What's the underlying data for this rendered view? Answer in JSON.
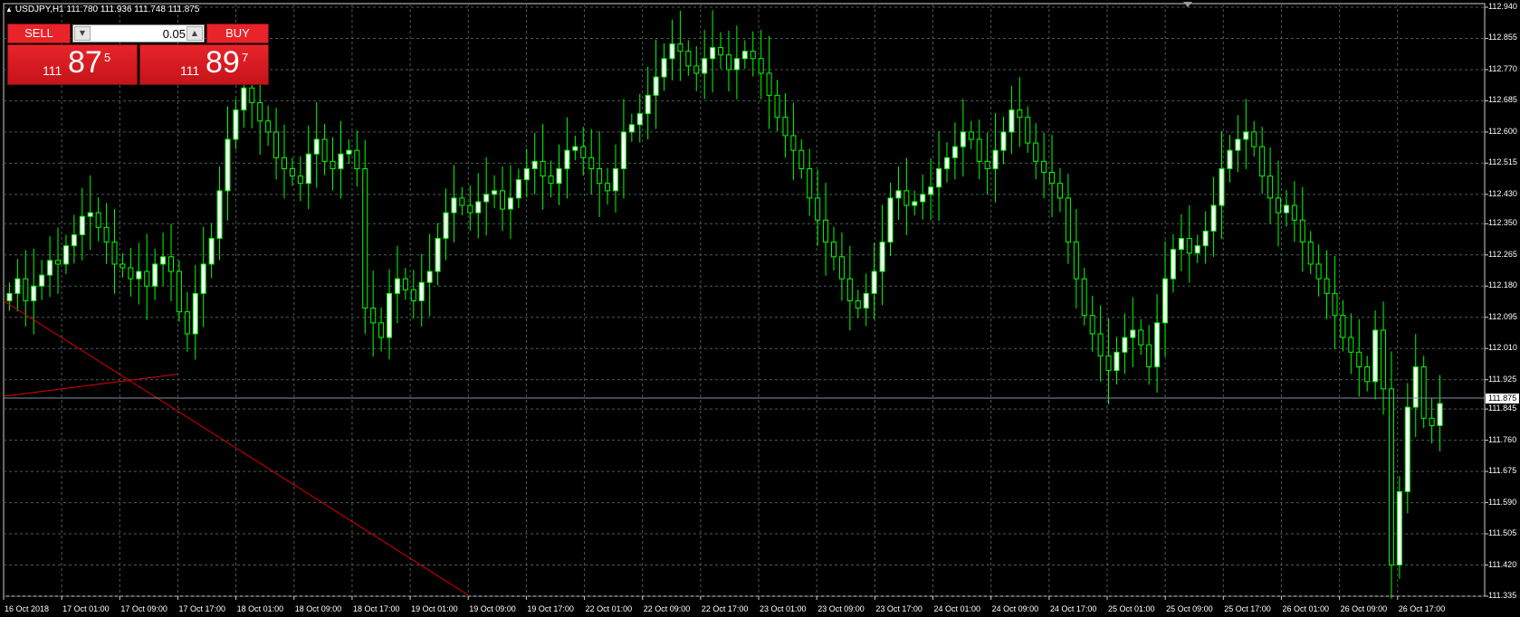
{
  "header": {
    "symbol_line": "USDJPY,H1  111.780 111.936 111.748 111.875"
  },
  "trade_panel": {
    "sell_label": "SELL",
    "buy_label": "BUY",
    "lot": "0.05",
    "sell_price": {
      "prefix": "111",
      "big": "87",
      "sup": "5"
    },
    "buy_price": {
      "prefix": "111",
      "big": "89",
      "sup": "7"
    }
  },
  "current_price_label": "111.875",
  "colors": {
    "background": "#000000",
    "grid": "#4a5a5a",
    "candle_bull": "#ffffff",
    "candle_bear": "#000000",
    "candle_outline": "#00ff00",
    "trendline": "#e00000",
    "bid_line": "#7f8fa6",
    "button": "#e8232a"
  },
  "chart_data": {
    "type": "candlestick",
    "symbol": "USDJPY",
    "timeframe": "H1",
    "ylim": [
      111.335,
      112.94
    ],
    "y_ticks": [
      "112.940",
      "112.855",
      "112.770",
      "112.685",
      "112.600",
      "112.515",
      "112.430",
      "112.350",
      "112.265",
      "112.180",
      "112.095",
      "112.010",
      "111.925",
      "111.845",
      "111.760",
      "111.675",
      "111.590",
      "111.505",
      "111.420",
      "111.335"
    ],
    "x_ticks": [
      "16 Oct 2018",
      "17 Oct 01:00",
      "17 Oct 09:00",
      "17 Oct 17:00",
      "18 Oct 01:00",
      "18 Oct 09:00",
      "18 Oct 17:00",
      "19 Oct 01:00",
      "19 Oct 09:00",
      "19 Oct 17:00",
      "22 Oct 01:00",
      "22 Oct 09:00",
      "22 Oct 17:00",
      "23 Oct 01:00",
      "23 Oct 09:00",
      "23 Oct 17:00",
      "24 Oct 01:00",
      "24 Oct 09:00",
      "24 Oct 17:00",
      "25 Oct 01:00",
      "25 Oct 09:00",
      "25 Oct 17:00",
      "26 Oct 01:00",
      "26 Oct 09:00",
      "26 Oct 17:00"
    ],
    "grid": true,
    "current_price": 111.875,
    "candles_close": [
      112.16,
      112.2,
      112.14,
      112.18,
      112.21,
      112.25,
      112.24,
      112.29,
      112.32,
      112.37,
      112.38,
      112.34,
      112.3,
      112.24,
      112.23,
      112.2,
      112.22,
      112.18,
      112.24,
      112.26,
      112.22,
      112.11,
      112.05,
      112.16,
      112.24,
      112.31,
      112.44,
      112.58,
      112.66,
      112.72,
      112.68,
      112.63,
      112.6,
      112.53,
      112.5,
      112.48,
      112.46,
      112.54,
      112.58,
      112.52,
      112.5,
      112.54,
      112.55,
      112.5,
      112.12,
      112.08,
      112.04,
      112.16,
      112.2,
      112.17,
      112.14,
      112.19,
      112.22,
      112.31,
      112.38,
      112.42,
      112.4,
      112.38,
      112.41,
      112.43,
      112.44,
      112.39,
      112.42,
      112.47,
      112.5,
      112.52,
      112.48,
      112.46,
      112.5,
      112.55,
      112.56,
      112.53,
      112.5,
      112.46,
      112.44,
      112.5,
      112.6,
      112.62,
      112.65,
      112.7,
      112.75,
      112.8,
      112.84,
      112.82,
      112.78,
      112.76,
      112.8,
      112.83,
      112.81,
      112.77,
      112.8,
      112.82,
      112.8,
      112.76,
      112.7,
      112.64,
      112.59,
      112.55,
      112.5,
      112.42,
      112.36,
      112.3,
      112.26,
      112.2,
      112.14,
      112.12,
      112.16,
      112.22,
      112.3,
      112.42,
      112.44,
      112.4,
      112.41,
      112.43,
      112.45,
      112.5,
      112.53,
      112.56,
      112.6,
      112.58,
      112.52,
      112.5,
      112.55,
      112.6,
      112.66,
      112.64,
      112.57,
      112.52,
      112.49,
      112.46,
      112.42,
      112.3,
      112.2,
      112.1,
      112.05,
      111.99,
      111.95,
      112.0,
      112.04,
      112.06,
      112.02,
      111.96,
      112.08,
      112.2,
      112.28,
      112.31,
      112.27,
      112.29,
      112.33,
      112.4,
      112.5,
      112.55,
      112.58,
      112.6,
      112.56,
      112.48,
      112.42,
      112.38,
      112.4,
      112.36,
      112.3,
      112.24,
      112.2,
      112.16,
      112.1,
      112.04,
      112.0,
      111.96,
      111.92,
      112.06,
      111.9,
      111.42,
      111.62,
      111.85,
      111.96,
      111.82,
      111.8,
      111.86
    ],
    "trendlines": [
      {
        "from": [
          "16 Oct 2018",
          112.14
        ],
        "to": [
          "19 Oct 09:00",
          111.338
        ]
      },
      {
        "from": [
          "16 Oct 2018",
          111.88
        ],
        "to": [
          "17 Oct 17:00",
          111.94
        ]
      }
    ]
  }
}
